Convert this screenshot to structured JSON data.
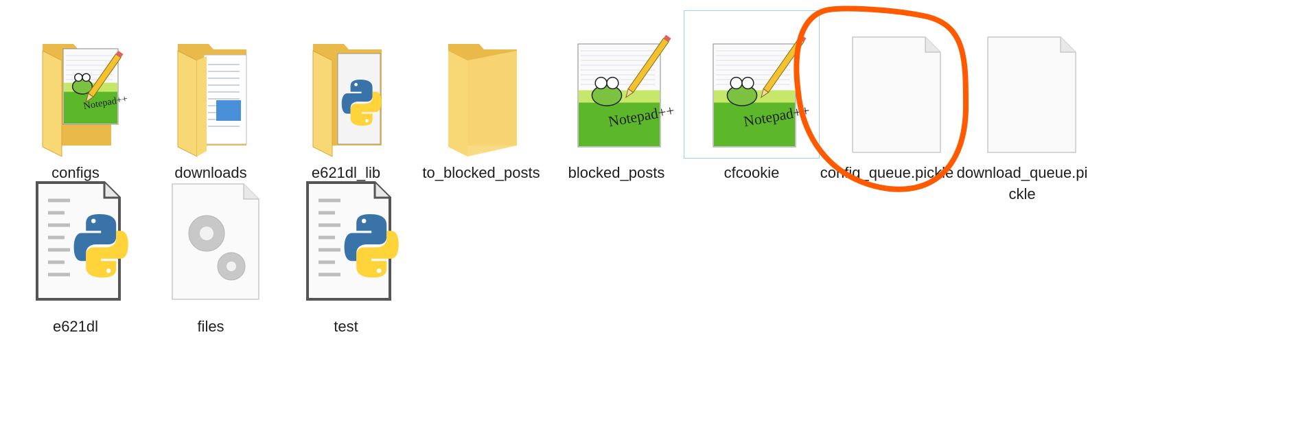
{
  "items": [
    {
      "name": "configs",
      "type": "folder-notepad",
      "row": 0,
      "col": 0
    },
    {
      "name": "downloads",
      "type": "folder-docs",
      "row": 0,
      "col": 1
    },
    {
      "name": "e621dl_lib",
      "type": "folder-python",
      "row": 0,
      "col": 2
    },
    {
      "name": "to_blocked_posts",
      "type": "folder-empty",
      "row": 0,
      "col": 3
    },
    {
      "name": "blocked_posts",
      "type": "notepad-file",
      "row": 0,
      "col": 4
    },
    {
      "name": "cfcookie",
      "type": "notepad-file",
      "row": 0,
      "col": 5,
      "selected": true
    },
    {
      "name": "config_queue.pickle",
      "type": "blank-file",
      "row": 0,
      "col": 6
    },
    {
      "name": "download_queue.pickle",
      "type": "blank-file",
      "row": 0,
      "col": 7
    },
    {
      "name": "e621dl",
      "type": "python-file",
      "row": 1,
      "col": 0
    },
    {
      "name": "files",
      "type": "gear-file",
      "row": 1,
      "col": 1
    },
    {
      "name": "test",
      "type": "python-file",
      "row": 1,
      "col": 2
    }
  ],
  "annotation": {
    "shape": "freehand-circle",
    "color": "#ff5a00",
    "target": "cfcookie"
  },
  "colors": {
    "folder": "#f8d775",
    "folder_dark": "#e9b949",
    "python_blue": "#3a73a8",
    "python_yellow": "#ffd43b",
    "selection": "#cce8ff"
  }
}
